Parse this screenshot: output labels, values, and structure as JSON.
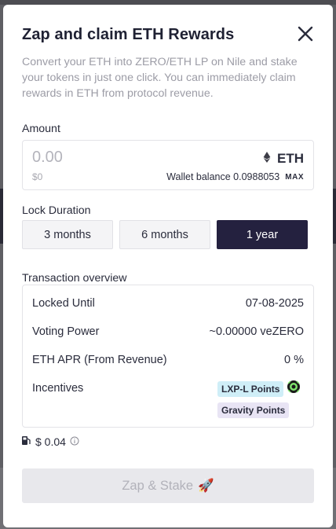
{
  "modal": {
    "title": "Zap and claim ETH Rewards",
    "subtitle": "Convert your ETH into ZERO/ETH LP on Nile and stake your tokens in just one click. You can immediately claim rewards in ETH from protocol revenue."
  },
  "amount": {
    "label": "Amount",
    "placeholder": "0.00",
    "usd_value": "$0",
    "token_symbol": "ETH",
    "token_icon": "ethereum-icon",
    "wallet_balance_label": "Wallet balance",
    "wallet_balance_value": "0.0988053",
    "max_label": "MAX"
  },
  "lock": {
    "label": "Lock Duration",
    "options": [
      "3 months",
      "6 months",
      "1 year"
    ],
    "selected": "1 year"
  },
  "overview": {
    "label": "Transaction overview",
    "rows": [
      {
        "label": "Locked Until",
        "value": "07-08-2025"
      },
      {
        "label": "Voting Power",
        "value": "~0.00000 veZERO"
      },
      {
        "label": "ETH APR (From Revenue)",
        "value": "0 %"
      }
    ],
    "incentives_label": "Incentives",
    "incentives": [
      "LXP-L Points",
      "Gravity Points"
    ]
  },
  "fee": {
    "icon": "gas-pump-icon",
    "value": "$ 0.04"
  },
  "action": {
    "label": "Zap & Stake",
    "emoji": "🚀"
  },
  "colors": {
    "accent": "#24213f",
    "lxp_badge": "#cfeef7",
    "gravity_badge": "#e8e4f4",
    "disabled_button": "#e8e8ec"
  }
}
